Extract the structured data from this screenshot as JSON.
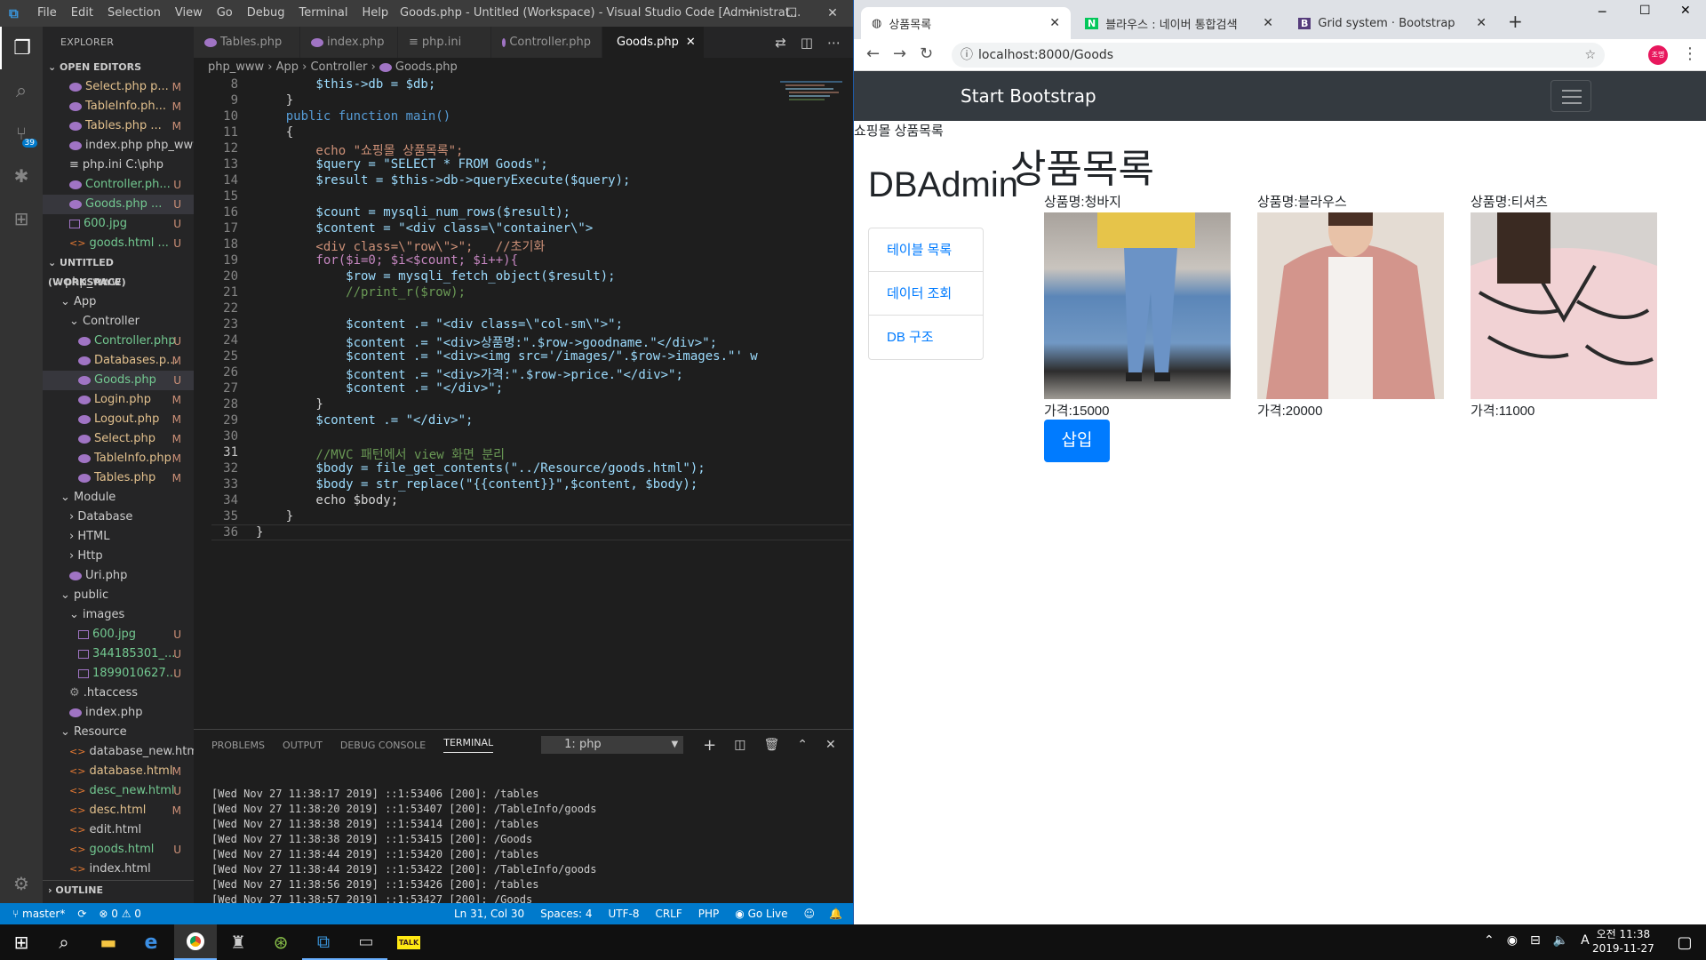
{
  "vscode": {
    "menu": [
      "File",
      "Edit",
      "Selection",
      "View",
      "Go",
      "Debug",
      "Terminal",
      "Help"
    ],
    "title": "Goods.php - Untitled (Workspace) - Visual Studio Code [Administrat...",
    "explorer_label": "EXPLORER",
    "open_editors_label": "OPEN EDITORS",
    "open_editors": [
      {
        "name": "Select.php p...",
        "status": "M"
      },
      {
        "name": "TableInfo.ph...",
        "status": "M"
      },
      {
        "name": "Tables.php ...",
        "status": "M"
      },
      {
        "name": "index.php php_www...",
        "status": ""
      },
      {
        "name": "php.ini C:\\php",
        "status": ""
      },
      {
        "name": "Controller.ph...",
        "status": "U"
      },
      {
        "name": "Goods.php ...",
        "status": "U"
      },
      {
        "name": "600.jpg",
        "status": "U"
      },
      {
        "name": "goods.html ...",
        "status": "U"
      }
    ],
    "workspace_label": "UNTITLED (WORKSPACE)",
    "tree": [
      {
        "name": "php_www",
        "status": "",
        "depth": 0,
        "kind": "folder"
      },
      {
        "name": "App",
        "status": "",
        "depth": 1,
        "kind": "folder"
      },
      {
        "name": "Controller",
        "status": "",
        "depth": 2,
        "kind": "folder"
      },
      {
        "name": "Controller.php",
        "status": "U",
        "depth": 3,
        "kind": "php"
      },
      {
        "name": "Databases.p...",
        "status": "M",
        "depth": 3,
        "kind": "php"
      },
      {
        "name": "Goods.php",
        "status": "U",
        "depth": 3,
        "kind": "php"
      },
      {
        "name": "Login.php",
        "status": "M",
        "depth": 3,
        "kind": "php"
      },
      {
        "name": "Logout.php",
        "status": "M",
        "depth": 3,
        "kind": "php"
      },
      {
        "name": "Select.php",
        "status": "M",
        "depth": 3,
        "kind": "php"
      },
      {
        "name": "TableInfo.php",
        "status": "M",
        "depth": 3,
        "kind": "php"
      },
      {
        "name": "Tables.php",
        "status": "M",
        "depth": 3,
        "kind": "php"
      },
      {
        "name": "Module",
        "status": "",
        "depth": 1,
        "kind": "folder"
      },
      {
        "name": "Database",
        "status": "",
        "depth": 2,
        "kind": "folder-c"
      },
      {
        "name": "HTML",
        "status": "",
        "depth": 2,
        "kind": "folder-c"
      },
      {
        "name": "Http",
        "status": "",
        "depth": 2,
        "kind": "folder-c"
      },
      {
        "name": "Uri.php",
        "status": "",
        "depth": 2,
        "kind": "php"
      },
      {
        "name": "public",
        "status": "",
        "depth": 1,
        "kind": "folder"
      },
      {
        "name": "images",
        "status": "",
        "depth": 2,
        "kind": "folder"
      },
      {
        "name": "600.jpg",
        "status": "U",
        "depth": 3,
        "kind": "img"
      },
      {
        "name": "344185301_...",
        "status": "U",
        "depth": 3,
        "kind": "img"
      },
      {
        "name": "1899010627...",
        "status": "U",
        "depth": 3,
        "kind": "img"
      },
      {
        "name": ".htaccess",
        "status": "",
        "depth": 2,
        "kind": "cfg"
      },
      {
        "name": "index.php",
        "status": "",
        "depth": 2,
        "kind": "php"
      },
      {
        "name": "Resource",
        "status": "",
        "depth": 1,
        "kind": "folder"
      },
      {
        "name": "database_new.html",
        "status": "",
        "depth": 2,
        "kind": "html"
      },
      {
        "name": "database.html",
        "status": "M",
        "depth": 2,
        "kind": "html"
      },
      {
        "name": "desc_new.html",
        "status": "U",
        "depth": 2,
        "kind": "html"
      },
      {
        "name": "desc.html",
        "status": "M",
        "depth": 2,
        "kind": "html"
      },
      {
        "name": "edit.html",
        "status": "",
        "depth": 2,
        "kind": "html"
      },
      {
        "name": "goods.html",
        "status": "U",
        "depth": 2,
        "kind": "html"
      },
      {
        "name": "index.html",
        "status": "",
        "depth": 2,
        "kind": "html"
      }
    ],
    "outline_label": "OUTLINE",
    "tabs": [
      "Tables.php",
      "index.php",
      "php.ini",
      "Controller.php",
      "Goods.php"
    ],
    "breadcrumb": [
      "php_www",
      "App",
      "Controller",
      "Goods.php"
    ],
    "code_lines": [
      {
        "n": "8",
        "t": "        $this->db = $db;"
      },
      {
        "n": "9",
        "t": "    }"
      },
      {
        "n": "10",
        "t": "    public function main()"
      },
      {
        "n": "11",
        "t": "    {"
      },
      {
        "n": "12",
        "t": "        echo \"쇼핑몰 상품목록\";"
      },
      {
        "n": "13",
        "t": "        $query = \"SELECT * FROM Goods\";"
      },
      {
        "n": "14",
        "t": "        $result = $this->db->queryExecute($query);"
      },
      {
        "n": "15",
        "t": ""
      },
      {
        "n": "16",
        "t": "        $count = mysqli_num_rows($result);"
      },
      {
        "n": "17",
        "t": "        $content = \"<div class=\\\"container\\\">"
      },
      {
        "n": "18",
        "t": "        <div class=\\\"row\\\">\";   //초기화"
      },
      {
        "n": "19",
        "t": "        for($i=0; $i<$count; $i++){"
      },
      {
        "n": "20",
        "t": "            $row = mysqli_fetch_object($result);"
      },
      {
        "n": "21",
        "t": "            //print_r($row);"
      },
      {
        "n": "22",
        "t": ""
      },
      {
        "n": "23",
        "t": "            $content .= \"<div class=\\\"col-sm\\\">\";"
      },
      {
        "n": "24",
        "t": "            $content .= \"<div>상품명:\".$row->goodname.\"</div>\";"
      },
      {
        "n": "25",
        "t": "            $content .= \"<div><img src='/images/\".$row->images.\"' w"
      },
      {
        "n": "26",
        "t": "            $content .= \"<div>가격:\".$row->price.\"</div>\";"
      },
      {
        "n": "27",
        "t": "            $content .= \"</div>\";"
      },
      {
        "n": "28",
        "t": "        }"
      },
      {
        "n": "29",
        "t": "        $content .= \"</div>\";"
      },
      {
        "n": "30",
        "t": ""
      },
      {
        "n": "31",
        "t": "        //MVC 패턴에서 view 화면 분리"
      },
      {
        "n": "32",
        "t": "        $body = file_get_contents(\"../Resource/goods.html\");"
      },
      {
        "n": "33",
        "t": "        $body = str_replace(\"{{content}}\",$content, $body);"
      },
      {
        "n": "34",
        "t": "        echo $body;"
      },
      {
        "n": "35",
        "t": "    }"
      },
      {
        "n": "36",
        "t": "}"
      }
    ],
    "panel_tabs": [
      "PROBLEMS",
      "OUTPUT",
      "DEBUG CONSOLE",
      "TERMINAL"
    ],
    "terminal_select": "1: php",
    "terminal_lines": [
      "[Wed Nov 27 11:38:17 2019] ::1:53406 [200]: /tables",
      "[Wed Nov 27 11:38:20 2019] ::1:53407 [200]: /TableInfo/goods",
      "[Wed Nov 27 11:38:38 2019] ::1:53414 [200]: /tables",
      "[Wed Nov 27 11:38:38 2019] ::1:53415 [200]: /Goods",
      "[Wed Nov 27 11:38:44 2019] ::1:53420 [200]: /tables",
      "[Wed Nov 27 11:38:44 2019] ::1:53422 [200]: /TableInfo/goods",
      "[Wed Nov 27 11:38:56 2019] ::1:53426 [200]: /tables",
      "[Wed Nov 27 11:38:57 2019] ::1:53427 [200]: /Goods"
    ],
    "status": {
      "branch": "master*",
      "problems": "⊗ 0 ⚠ 0",
      "position": "Ln 31, Col 30",
      "spaces": "Spaces: 4",
      "encoding": "UTF-8",
      "eol": "CRLF",
      "lang": "PHP",
      "golive": "Go Live"
    },
    "scm_badge": "39"
  },
  "chrome": {
    "tabs": [
      {
        "title": "상품목록"
      },
      {
        "title": "블라우스 : 네이버 통합검색"
      },
      {
        "title": "Grid system · Bootstrap"
      }
    ],
    "url": "localhost:8000/Goods",
    "brand": "Start Bootstrap",
    "echo_text": "쇼핑몰 상품목록",
    "heading": "상품목록",
    "sidebar_title": "DBAdmin",
    "menu": [
      "테이블 목록",
      "데이터 조회",
      "DB 구조"
    ],
    "products": [
      {
        "name": "상품명:청바지",
        "price": "가격:15000"
      },
      {
        "name": "상품명:블라우스",
        "price": "가격:20000"
      },
      {
        "name": "상품명:티셔츠",
        "price": "가격:11000"
      }
    ],
    "insert_button": "삽입",
    "avatar": "조명"
  },
  "taskbar": {
    "time": "오전 11:38",
    "date": "2019-11-27",
    "ime": "A"
  }
}
